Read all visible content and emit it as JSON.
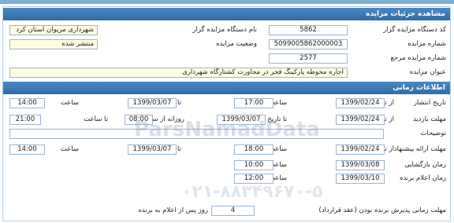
{
  "details": {
    "header": "مشاهده جزئیات مزایده",
    "device_code_label": "کد دستگاه مزایده گزار",
    "device_code": "5862",
    "device_name_label": "نام دستگاه مزایده گزار",
    "device_name": "شهرداری مریوان استان کرد",
    "auction_number_label": "شماره مزایده",
    "auction_number": "5099005862000003",
    "status_label": "وضعیت مزایده",
    "status": "منتشر شده",
    "ref_number_label": "شماره مزایده مرجع",
    "ref_number": "2577",
    "title_label": "عنوان مزایده",
    "title": "اجاره محوطه پارکینگ فجر در مجاورت کشتارگاه شهرداری"
  },
  "timing": {
    "header": "اطلاعات زمانی",
    "from_date_label": "از تاریخ",
    "to_date_label": "تا تاریخ",
    "time_label": "ساعت",
    "to_time_label": "تا ساعت",
    "publish": {
      "label": "تاریخ انتشار",
      "from": "1399/02/24",
      "time": "17:00",
      "to": "1399/03/07",
      "to_time": "14:00"
    },
    "visit": {
      "label": "مهلت بازدید",
      "from": "1399/02/24",
      "to": "1399/03/07",
      "daily_label": "روزانه از ساعت",
      "daily_from": "08:00",
      "daily_to": "21:00"
    },
    "desc_label": "توضیحات",
    "bids": {
      "label": "مهلت ارائه پیشنهاد",
      "from": "1399/02/24",
      "time": "18:00",
      "to": "1399/03/07",
      "to_time": "14:00"
    },
    "opening": {
      "label": "زمان بازگشایی",
      "date": "1399/03/08",
      "time": "10:00"
    },
    "winner": {
      "label": "زمان اعلام برنده",
      "date": "1399/03/10",
      "time": "12:00"
    },
    "contract_label": "مهلت زمانی پذیرش برنده بودن (عقد قرارداد)",
    "contract_days": "4",
    "contract_suffix": "روز پس از اعلام به برنده"
  },
  "watermark": {
    "text1": "ParsNamadData",
    "text2": "۰۲۱-۸۸۳۴۹۶۷۰-۵"
  }
}
